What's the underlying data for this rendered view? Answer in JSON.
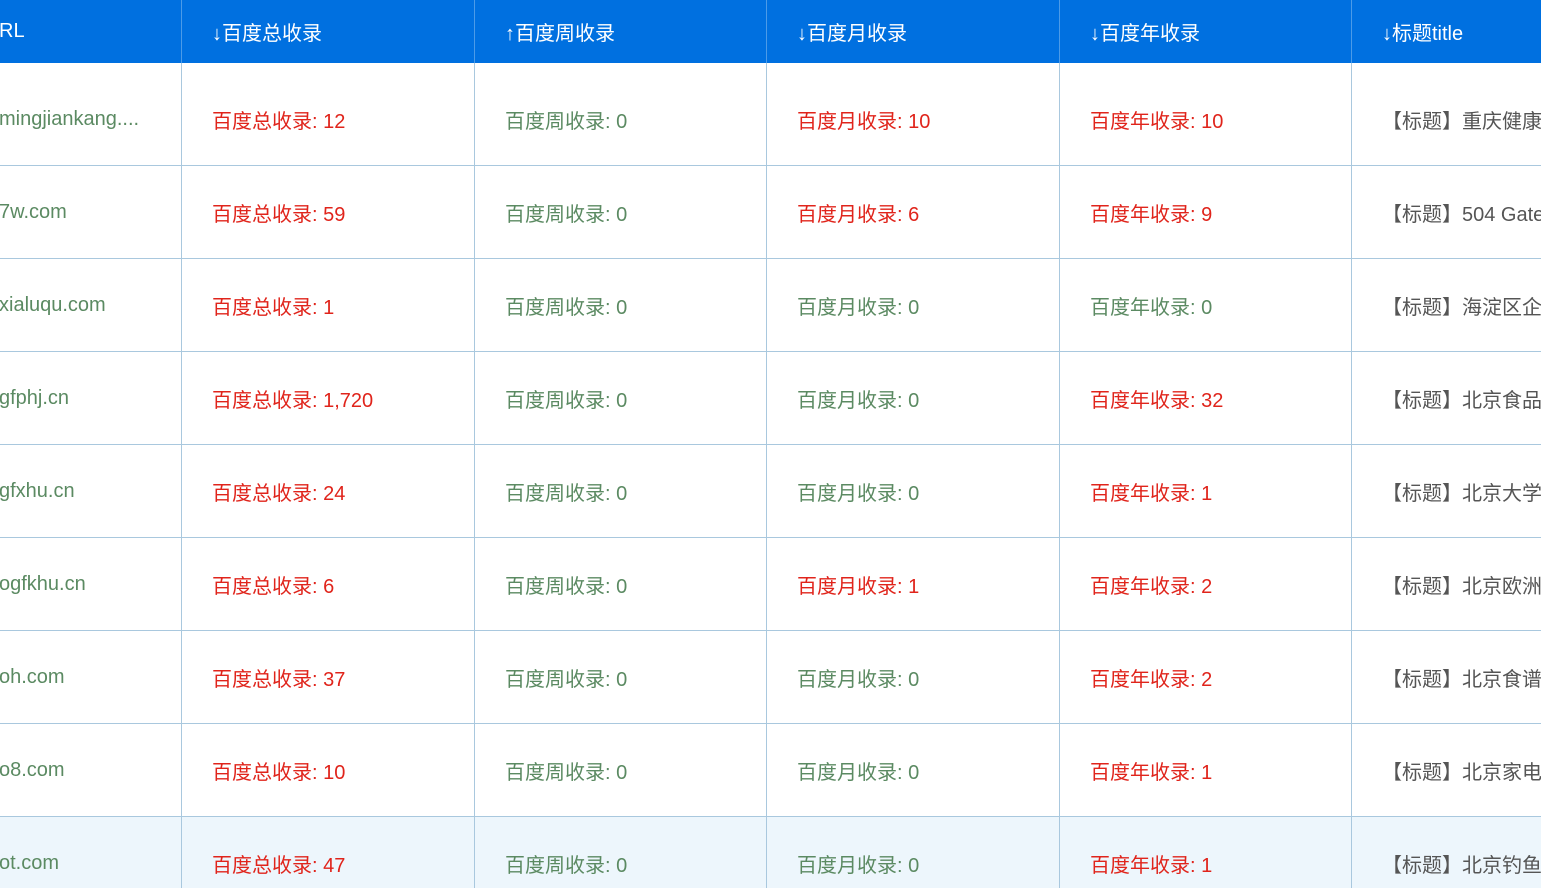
{
  "header": {
    "url": "RL",
    "total": "↓百度总收录",
    "week": "↑百度周收录",
    "month": "↓百度月收录",
    "year": "↓百度年收录",
    "title": "↓标题title"
  },
  "colors": {
    "header_bg": "#0070e0",
    "zero_value": "#5b8a62",
    "nonzero_value": "#e0241b",
    "border": "#a9c8de",
    "highlight_row": "#edf6fc"
  },
  "rows": [
    {
      "url": "mingjiankang....",
      "total": "百度总收录: 12",
      "week": "百度周收录: 0",
      "month": "百度月收录: 10",
      "year": "百度年收录: 10",
      "title": "【标题】重庆健康"
    },
    {
      "url": "7w.com",
      "total": "百度总收录: 59",
      "week": "百度周收录: 0",
      "month": "百度月收录: 6",
      "year": "百度年收录: 9",
      "title": "【标题】504 Gate"
    },
    {
      "url": "xialuqu.com",
      "total": "百度总收录: 1",
      "week": "百度周收录: 0",
      "month": "百度月收录: 0",
      "year": "百度年收录: 0",
      "title": "【标题】海淀区企"
    },
    {
      "url": "gfphj.cn",
      "total": "百度总收录: 1,720",
      "week": "百度周收录: 0",
      "month": "百度月收录: 0",
      "year": "百度年收录: 32",
      "title": "【标题】北京食品"
    },
    {
      "url": "gfxhu.cn",
      "total": "百度总收录: 24",
      "week": "百度周收录: 0",
      "month": "百度月收录: 0",
      "year": "百度年收录: 1",
      "title": "【标题】北京大学"
    },
    {
      "url": "ogfkhu.cn",
      "total": "百度总收录: 6",
      "week": "百度周收录: 0",
      "month": "百度月收录: 1",
      "year": "百度年收录: 2",
      "title": "【标题】北京欧洲"
    },
    {
      "url": "oh.com",
      "total": "百度总收录: 37",
      "week": "百度周收录: 0",
      "month": "百度月收录: 0",
      "year": "百度年收录: 2",
      "title": "【标题】北京食谱"
    },
    {
      "url": "o8.com",
      "total": "百度总收录: 10",
      "week": "百度周收录: 0",
      "month": "百度月收录: 0",
      "year": "百度年收录: 1",
      "title": "【标题】北京家电"
    },
    {
      "url": "ot.com",
      "total": "百度总收录: 47",
      "week": "百度周收录: 0",
      "month": "百度月收录: 0",
      "year": "百度年收录: 1",
      "title": "【标题】北京钓鱼"
    }
  ]
}
